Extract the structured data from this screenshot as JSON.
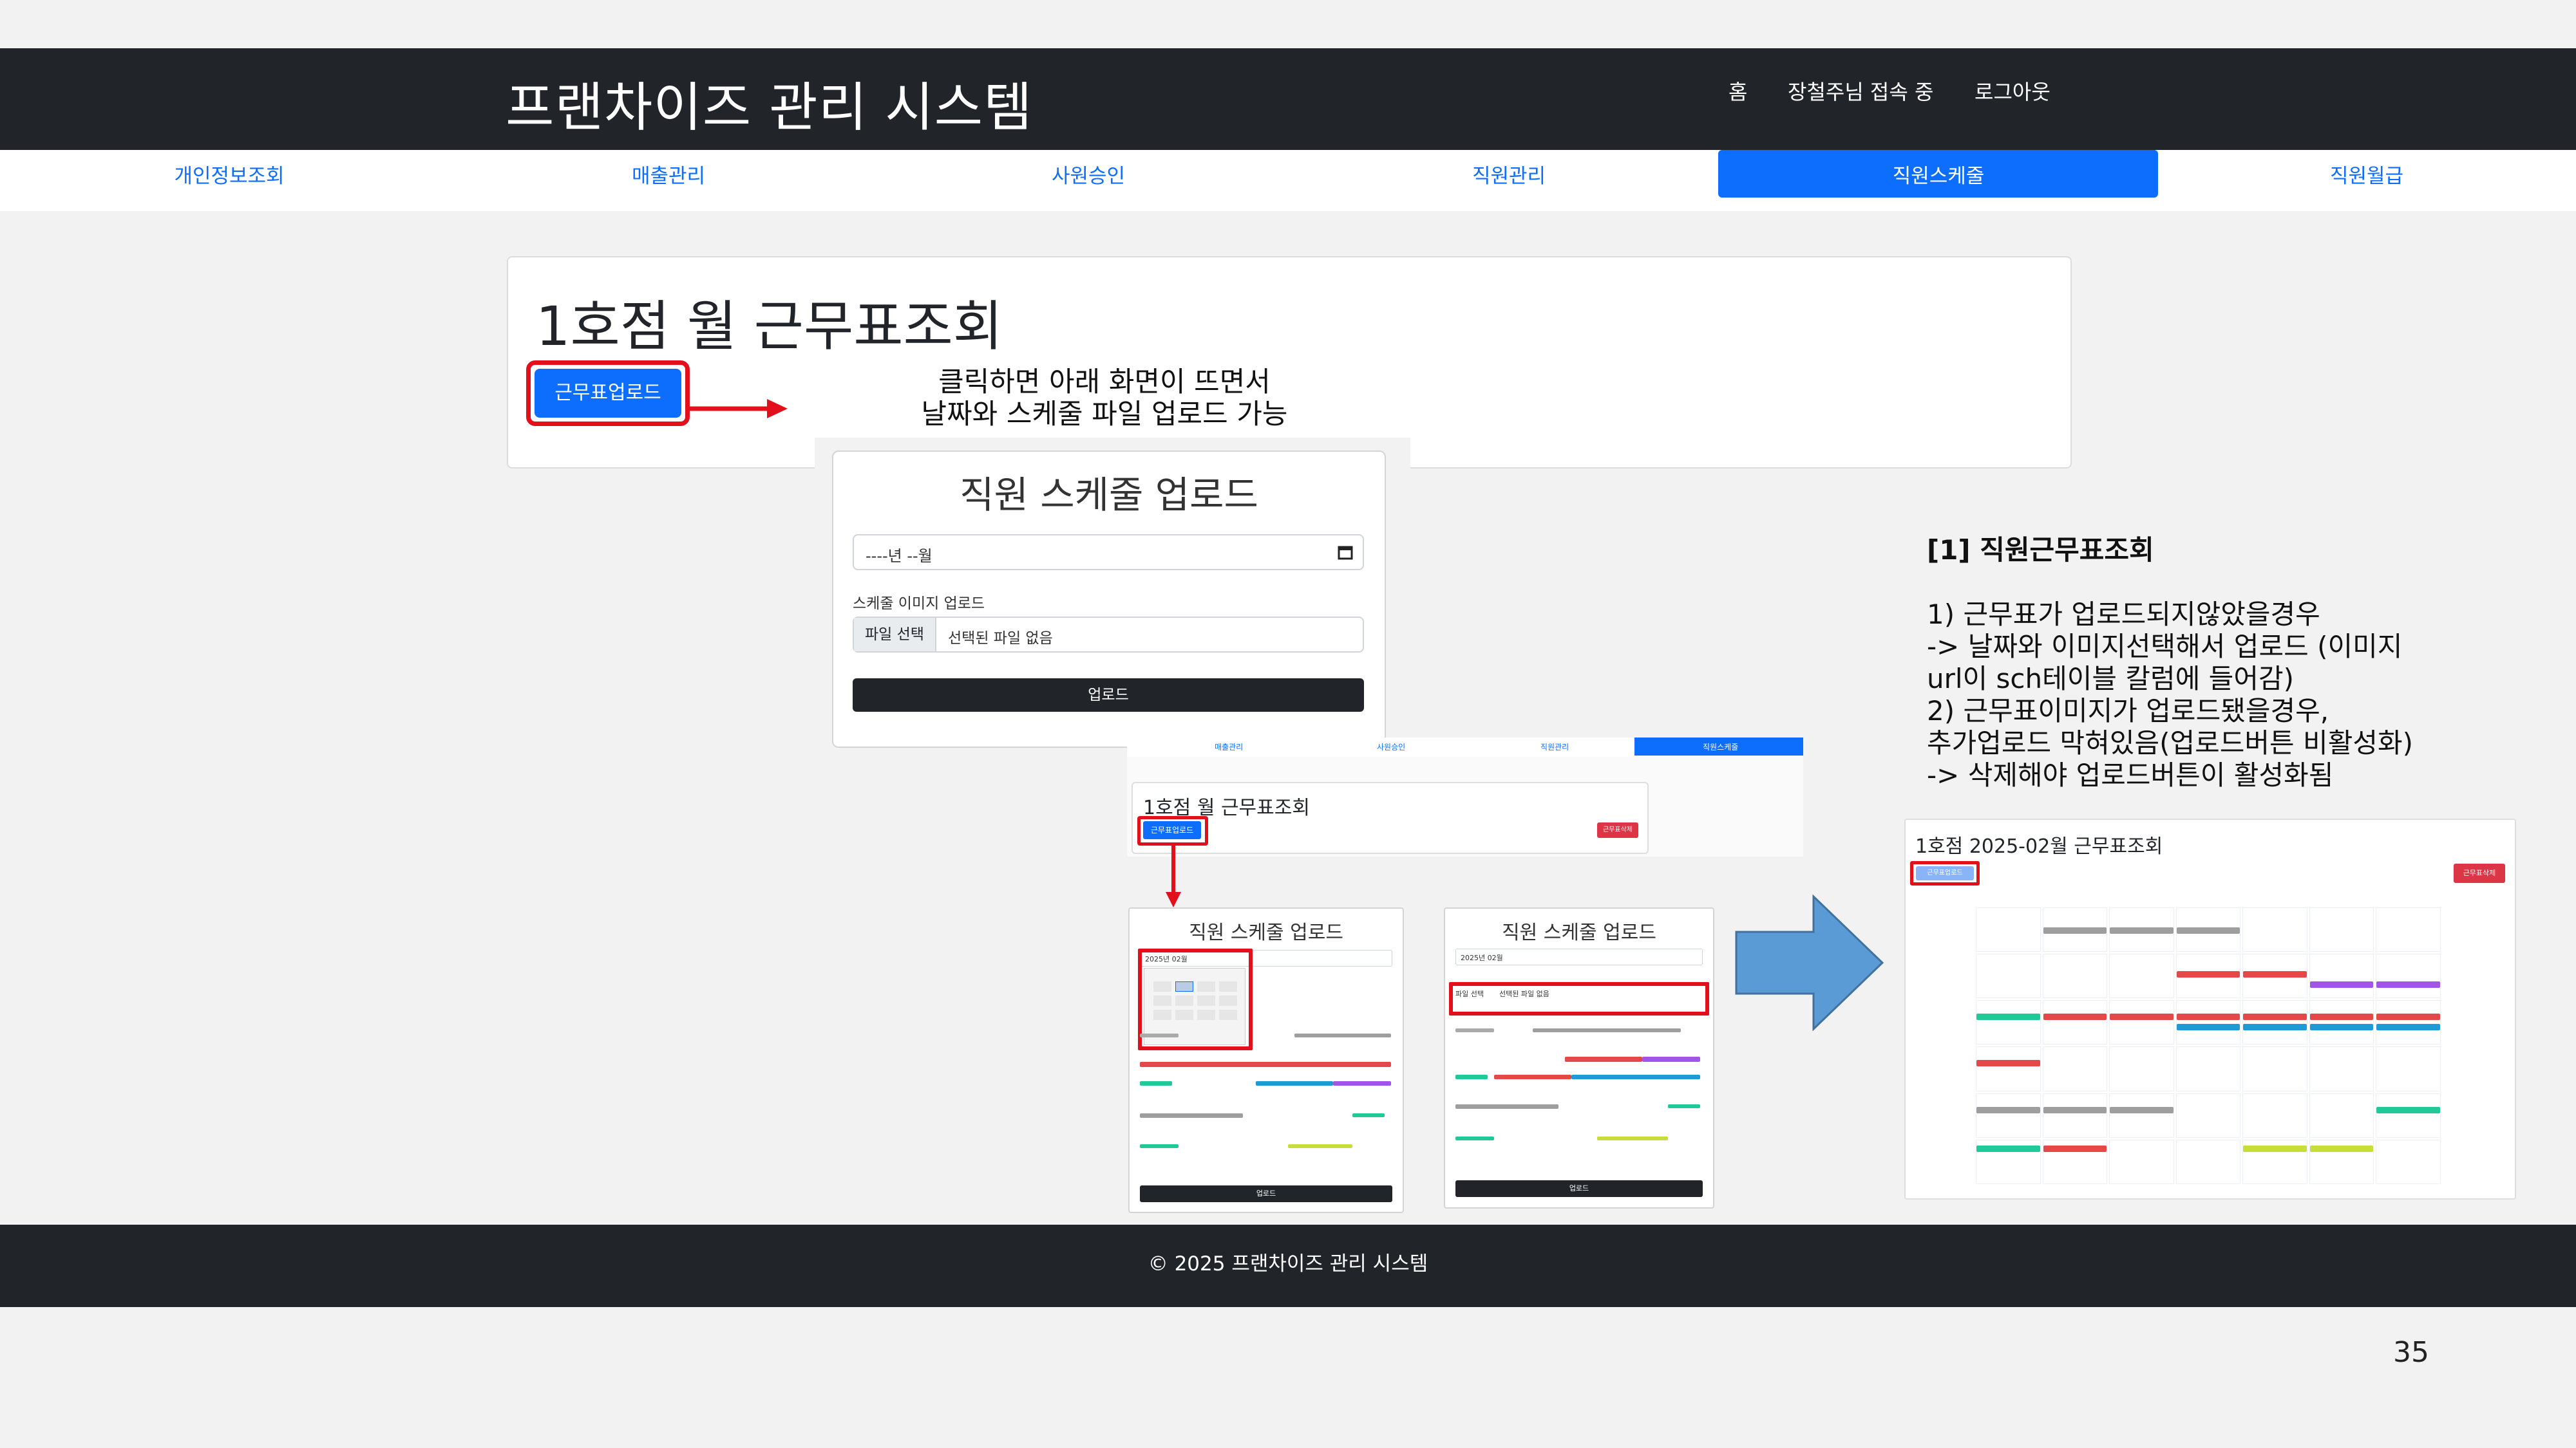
{
  "header": {
    "brand": "프랜차이즈 관리 시스템",
    "links": [
      "홈",
      "장철주님 접속 중",
      "로그아웃"
    ]
  },
  "nav": {
    "items": [
      "개인정보조회",
      "매출관리",
      "사원승인",
      "직원관리",
      "직원스케줄",
      "직원월급"
    ],
    "active_index": 4
  },
  "main": {
    "title": "1호점 월 근무표조회",
    "upload_button": "근무표업로드",
    "annotation_line1": "클릭하면 아래 화면이 뜨면서",
    "annotation_line2": "날짜와 스케줄 파일 업로드 가능"
  },
  "upload_modal": {
    "title": "직원 스케줄 업로드",
    "month_placeholder": "----년 --월",
    "file_label": "스케줄 이미지 업로드",
    "file_button": "파일 선택",
    "file_status": "선택된 파일 없음",
    "submit": "업로드"
  },
  "description": {
    "heading": "[1] 직원근무표조회",
    "lines": [
      "1) 근무표가 업로드되지않았을경우",
      "-> 날짜와 이미지선택해서 업로드 (이미지",
      "url이 sch테이블 칼럼에 들어감)",
      "2) 근무표이미지가 업로드됐을경우,",
      "추가업로드 막혀있음(업로드버튼 비활성화)",
      "-> 삭제해야 업로드버튼이 활성화됨"
    ]
  },
  "mini": {
    "tabs": [
      "매출관리",
      "사원승인",
      "직원관리",
      "직원스케줄"
    ],
    "title": "1호점 월 근무표조회",
    "upload": "근무표업로드",
    "delete": "근무표삭제",
    "modal_title": "직원 스케줄 업로드",
    "modal_month": "2025년 02월",
    "modal_file_button": "파일 선택",
    "modal_file_status": "선택된 파일 없음",
    "modal_submit": "업로드"
  },
  "result": {
    "title": "1호점 2025-02월 근무표조회",
    "upload": "근무표업로드",
    "delete": "근무표삭제"
  },
  "footer": {
    "text": "© 2025 프랜차이즈 관리 시스템"
  },
  "slide_number": "35",
  "colors": {
    "dark": "#212529",
    "primary": "#0d6efd",
    "highlight": "#e3101c",
    "arrow": "#5b9bd5"
  }
}
